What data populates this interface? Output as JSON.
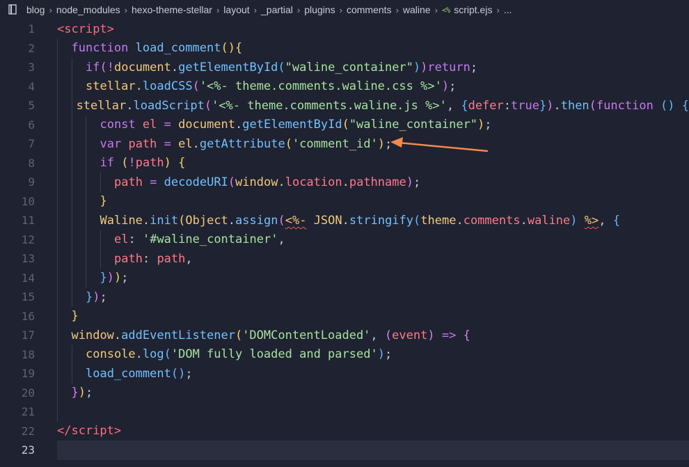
{
  "breadcrumb": {
    "items": [
      "blog",
      "node_modules",
      "hexo-theme-stellar",
      "layout",
      "_partial",
      "plugins",
      "comments",
      "waline"
    ],
    "file_icon_text": "<%",
    "file": "script.ejs",
    "more": "..."
  },
  "editor": {
    "current_line": 23,
    "lines": [
      {
        "n": "1",
        "indent": 0,
        "tokens": [
          [
            "t-tag",
            "<"
          ],
          [
            "t-tag",
            "script"
          ],
          [
            "t-tag",
            ">"
          ]
        ]
      },
      {
        "n": "2",
        "indent": 1,
        "tokens": [
          [
            "t-kw",
            "function "
          ],
          [
            "t-fn",
            "load_comment"
          ],
          [
            "t-brace1",
            "(){"
          ]
        ]
      },
      {
        "n": "3",
        "indent": 2,
        "tokens": [
          [
            "t-kw",
            "if"
          ],
          [
            "t-brace2",
            "("
          ],
          [
            "t-op",
            "!"
          ],
          [
            "t-id",
            "document"
          ],
          [
            "t-punc",
            "."
          ],
          [
            "t-fn",
            "getElementById"
          ],
          [
            "t-brace3",
            "("
          ],
          [
            "t-str",
            "\"waline_container\""
          ],
          [
            "t-brace3",
            ")"
          ],
          [
            "t-brace2",
            ")"
          ],
          [
            "t-kw",
            "return"
          ],
          [
            "t-punc",
            ";"
          ]
        ]
      },
      {
        "n": "4",
        "indent": 2,
        "tokens": [
          [
            "t-id",
            "stellar"
          ],
          [
            "t-punc",
            "."
          ],
          [
            "t-fn",
            "loadCSS"
          ],
          [
            "t-brace2",
            "("
          ],
          [
            "t-str",
            "'<%- theme.comments.waline.css %>'"
          ],
          [
            "t-brace2",
            ")"
          ],
          [
            "t-punc",
            ";"
          ]
        ]
      },
      {
        "n": "5",
        "indent": 2,
        "tokens": [
          [
            "t-id",
            "stellar"
          ],
          [
            "t-punc",
            "."
          ],
          [
            "t-fn",
            "loadScript"
          ],
          [
            "t-brace2",
            "("
          ],
          [
            "t-str",
            "'<%- theme.comments.waline.js %>'"
          ],
          [
            "t-punc",
            ", "
          ],
          [
            "t-brace3",
            "{"
          ],
          [
            "t-var",
            "defer"
          ],
          [
            "t-punc",
            ":"
          ],
          [
            "t-kw",
            "true"
          ],
          [
            "t-brace3",
            "}"
          ],
          [
            "t-brace2",
            ")"
          ],
          [
            "t-punc",
            "."
          ],
          [
            "t-fn",
            "then"
          ],
          [
            "t-brace2",
            "("
          ],
          [
            "t-kw",
            "function "
          ],
          [
            "t-brace3",
            "() {"
          ]
        ]
      },
      {
        "n": "6",
        "indent": 3,
        "tokens": [
          [
            "t-kw",
            "const "
          ],
          [
            "t-var",
            "el "
          ],
          [
            "t-op",
            "= "
          ],
          [
            "t-id",
            "document"
          ],
          [
            "t-punc",
            "."
          ],
          [
            "t-fn",
            "getElementById"
          ],
          [
            "t-brace1",
            "("
          ],
          [
            "t-str",
            "\"waline_container\""
          ],
          [
            "t-brace1",
            ")"
          ],
          [
            "t-punc",
            ";"
          ]
        ]
      },
      {
        "n": "7",
        "indent": 3,
        "tokens": [
          [
            "t-kw",
            "var "
          ],
          [
            "t-var",
            "path "
          ],
          [
            "t-op",
            "= "
          ],
          [
            "t-id",
            "el"
          ],
          [
            "t-punc",
            "."
          ],
          [
            "t-fn",
            "getAttribute"
          ],
          [
            "t-brace1",
            "("
          ],
          [
            "t-str",
            "'comment_id'"
          ],
          [
            "t-brace1",
            ")"
          ],
          [
            "t-punc",
            ";"
          ]
        ]
      },
      {
        "n": "8",
        "indent": 3,
        "tokens": [
          [
            "t-kw",
            "if "
          ],
          [
            "t-brace1",
            "("
          ],
          [
            "t-op",
            "!"
          ],
          [
            "t-var",
            "path"
          ],
          [
            "t-brace1",
            ") "
          ],
          [
            "t-brace1",
            "{"
          ]
        ]
      },
      {
        "n": "9",
        "indent": 4,
        "tokens": [
          [
            "t-var",
            "path "
          ],
          [
            "t-op",
            "= "
          ],
          [
            "t-fn",
            "decodeURI"
          ],
          [
            "t-brace2",
            "("
          ],
          [
            "t-id",
            "window"
          ],
          [
            "t-punc",
            "."
          ],
          [
            "t-var",
            "location"
          ],
          [
            "t-punc",
            "."
          ],
          [
            "t-var",
            "pathname"
          ],
          [
            "t-brace2",
            ")"
          ],
          [
            "t-punc",
            ";"
          ]
        ]
      },
      {
        "n": "10",
        "indent": 3,
        "tokens": [
          [
            "t-brace1",
            "}"
          ]
        ]
      },
      {
        "n": "11",
        "indent": 3,
        "tokens": [
          [
            "t-id",
            "Waline"
          ],
          [
            "t-punc",
            "."
          ],
          [
            "t-fn",
            "init"
          ],
          [
            "t-brace1",
            "("
          ],
          [
            "t-id",
            "Object"
          ],
          [
            "t-punc",
            "."
          ],
          [
            "t-fn",
            "assign"
          ],
          [
            "t-brace2",
            "("
          ],
          [
            "t-ejs squiggle",
            "<%-"
          ],
          [
            "t-punc",
            " "
          ],
          [
            "t-id",
            "JSON"
          ],
          [
            "t-punc",
            "."
          ],
          [
            "t-fn",
            "stringify"
          ],
          [
            "t-brace3",
            "("
          ],
          [
            "t-id",
            "theme"
          ],
          [
            "t-punc",
            "."
          ],
          [
            "t-var",
            "comments"
          ],
          [
            "t-punc",
            "."
          ],
          [
            "t-var",
            "waline"
          ],
          [
            "t-brace3",
            ")"
          ],
          [
            "t-punc",
            " "
          ],
          [
            "t-ejs squiggle",
            "%>"
          ],
          [
            "t-punc",
            ", "
          ],
          [
            "t-brace3",
            "{"
          ]
        ]
      },
      {
        "n": "12",
        "indent": 4,
        "tokens": [
          [
            "t-var",
            "el"
          ],
          [
            "t-punc",
            ": "
          ],
          [
            "t-str",
            "'#waline_container'"
          ],
          [
            "t-punc",
            ","
          ]
        ]
      },
      {
        "n": "13",
        "indent": 4,
        "tokens": [
          [
            "t-var",
            "path"
          ],
          [
            "t-punc",
            ": "
          ],
          [
            "t-var",
            "path"
          ],
          [
            "t-punc",
            ","
          ]
        ]
      },
      {
        "n": "14",
        "indent": 3,
        "tokens": [
          [
            "t-brace3",
            "}"
          ],
          [
            "t-brace2",
            ")"
          ],
          [
            "t-brace1",
            ")"
          ],
          [
            "t-punc",
            ";"
          ]
        ]
      },
      {
        "n": "15",
        "indent": 2,
        "tokens": [
          [
            "t-brace3",
            "}"
          ],
          [
            "t-brace2",
            ")"
          ],
          [
            "t-punc",
            ";"
          ]
        ]
      },
      {
        "n": "16",
        "indent": 1,
        "tokens": [
          [
            "t-brace1",
            "}"
          ]
        ]
      },
      {
        "n": "17",
        "indent": 1,
        "tokens": [
          [
            "t-id",
            "window"
          ],
          [
            "t-punc",
            "."
          ],
          [
            "t-fn",
            "addEventListener"
          ],
          [
            "t-brace1",
            "("
          ],
          [
            "t-str",
            "'DOMContentLoaded'"
          ],
          [
            "t-punc",
            ", "
          ],
          [
            "t-brace2",
            "("
          ],
          [
            "t-var",
            "event"
          ],
          [
            "t-brace2",
            ")"
          ],
          [
            "t-punc",
            " "
          ],
          [
            "t-op",
            "=>"
          ],
          [
            "t-punc",
            " "
          ],
          [
            "t-brace2",
            "{"
          ]
        ]
      },
      {
        "n": "18",
        "indent": 2,
        "tokens": [
          [
            "t-id",
            "console"
          ],
          [
            "t-punc",
            "."
          ],
          [
            "t-fn",
            "log"
          ],
          [
            "t-brace3",
            "("
          ],
          [
            "t-str",
            "'DOM fully loaded and parsed'"
          ],
          [
            "t-brace3",
            ")"
          ],
          [
            "t-punc",
            ";"
          ]
        ]
      },
      {
        "n": "19",
        "indent": 2,
        "tokens": [
          [
            "t-fn",
            "load_comment"
          ],
          [
            "t-brace3",
            "()"
          ],
          [
            "t-punc",
            ";"
          ]
        ]
      },
      {
        "n": "20",
        "indent": 1,
        "tokens": [
          [
            "t-brace2",
            "}"
          ],
          [
            "t-brace1",
            ")"
          ],
          [
            "t-punc",
            ";"
          ]
        ]
      },
      {
        "n": "21",
        "indent": 1,
        "tokens": []
      },
      {
        "n": "22",
        "indent": 0,
        "tokens": [
          [
            "t-tag",
            "</"
          ],
          [
            "t-tag",
            "script"
          ],
          [
            "t-tag",
            ">"
          ]
        ]
      },
      {
        "n": "23",
        "indent": 0,
        "tokens": []
      }
    ]
  },
  "colors": {
    "background": "#1f2230",
    "current_line": "#2a2e3f",
    "annotation_arrow": "#f5894a"
  }
}
